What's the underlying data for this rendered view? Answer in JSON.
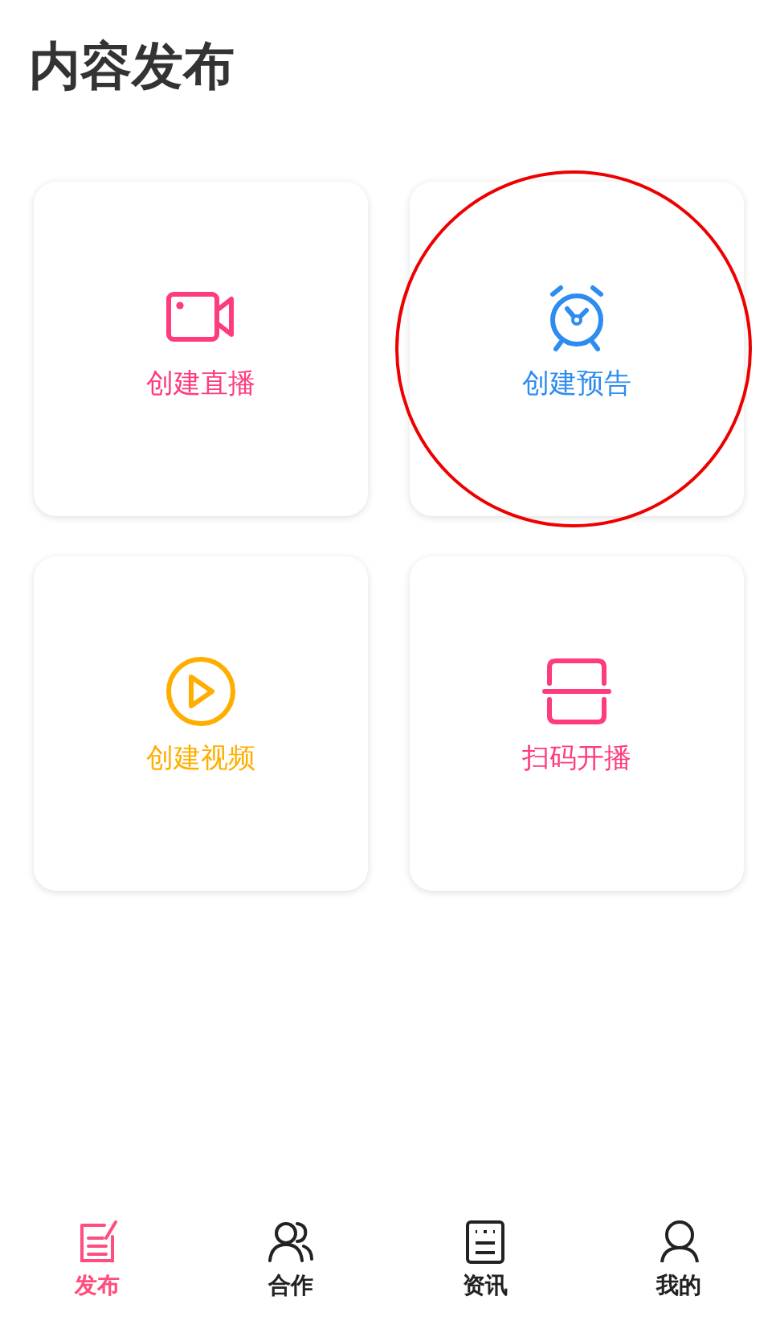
{
  "title": "内容发布",
  "actions": [
    {
      "label": "创建直播",
      "kind": "camera",
      "color": "#ff3b7f",
      "highlighted": false
    },
    {
      "label": "创建预告",
      "kind": "alarm",
      "color": "#2d8cf0",
      "highlighted": true
    },
    {
      "label": "创建视频",
      "kind": "play",
      "color": "#ffae00",
      "highlighted": false
    },
    {
      "label": "扫码开播",
      "kind": "scan",
      "color": "#ff3b7f",
      "highlighted": false
    }
  ],
  "tab_bar": [
    {
      "label": "发布",
      "kind": "edit",
      "selected": true
    },
    {
      "label": "合作",
      "kind": "people",
      "selected": false
    },
    {
      "label": "资讯",
      "kind": "news",
      "selected": false
    },
    {
      "label": "我的",
      "kind": "person",
      "selected": false
    }
  ]
}
